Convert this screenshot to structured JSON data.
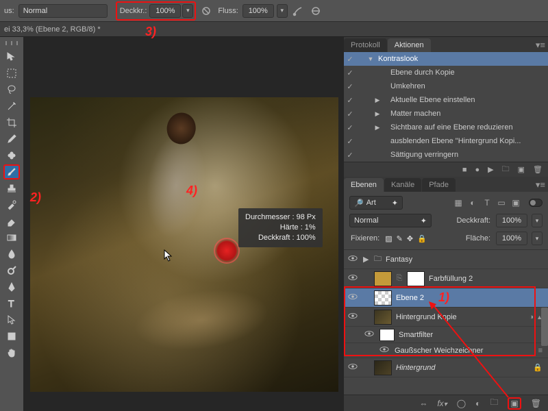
{
  "optbar": {
    "us_label": "us:",
    "mode": "Normal",
    "opacity_label": "Deckkr.:",
    "opacity_value": "100%",
    "flow_label": "Fluss:",
    "flow_value": "100%"
  },
  "tab_title": "ei 33,3% (Ebene 2, RGB/8) *",
  "brush_tooltip": {
    "l1": "Durchmesser : 98 Px",
    "l2": "Härte :    1%",
    "l3": "Deckkraft : 100%"
  },
  "panels": {
    "protokoll": "Protokoll",
    "aktionen": "Aktionen",
    "ebenen": "Ebenen",
    "kanale": "Kanäle",
    "pfade": "Pfade"
  },
  "actions": [
    {
      "name": "Kontraslook",
      "disc": "▼",
      "sel": true,
      "indent": 0
    },
    {
      "name": "Ebene durch Kopie",
      "indent": 1
    },
    {
      "name": "Umkehren",
      "indent": 1
    },
    {
      "name": "Aktuelle Ebene einstellen",
      "disc": "▶",
      "indent": 1
    },
    {
      "name": "Matter machen",
      "disc": "▶",
      "indent": 1
    },
    {
      "name": "Sichtbare auf eine Ebene reduzieren",
      "disc": "▶",
      "indent": 1
    },
    {
      "name": "ausblenden Ebene \"Hintergrund Kopi...",
      "indent": 1
    },
    {
      "name": "Sättigung verringern",
      "indent": 1
    }
  ],
  "layer_opts": {
    "kind": "Art",
    "blend": "Normal",
    "opacity_label": "Deckkraft:",
    "opacity_value": "100%",
    "lock_label": "Fixieren:",
    "fill_label": "Fläche:",
    "fill_value": "100%"
  },
  "layers": [
    {
      "name": "Fantasy",
      "type": "group"
    },
    {
      "name": "Farbfüllung 2",
      "type": "fill"
    },
    {
      "name": "Ebene 2",
      "type": "trans",
      "sel": true
    },
    {
      "name": "Hintergrund Kopie",
      "type": "smart"
    },
    {
      "name": "Smartfilter",
      "type": "filterhead"
    },
    {
      "name": "Gaußscher Weichzeichner",
      "type": "filter"
    },
    {
      "name": "Hintergrund",
      "type": "bg"
    }
  ],
  "anno": {
    "a1": "1)",
    "a2": "2)",
    "a3": "3)",
    "a4": "4)"
  }
}
